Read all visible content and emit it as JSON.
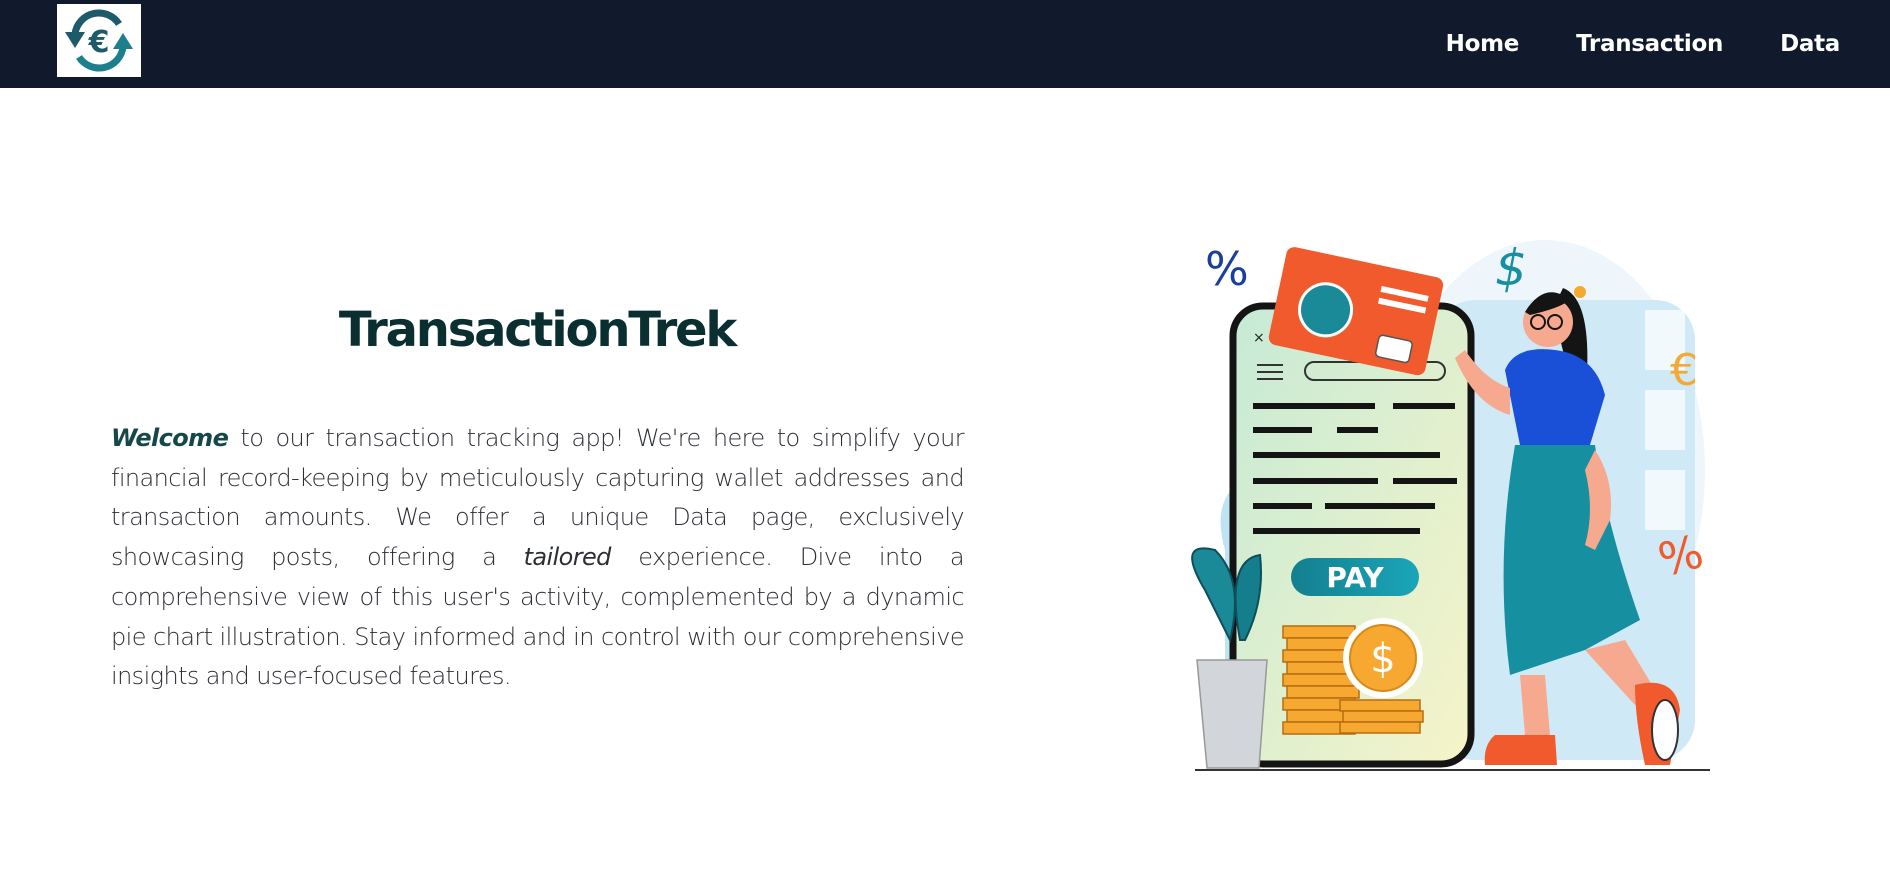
{
  "navbar": {
    "logo_icon": "euro-exchange-icon",
    "links": [
      {
        "label": "Home"
      },
      {
        "label": "Transaction"
      },
      {
        "label": "Data"
      }
    ]
  },
  "hero": {
    "title": "TransactionTrek",
    "welcome": "Welcome",
    "text_part1": " to our transaction tracking app! We're here to simplify your financial record-keeping by meticulously capturing wallet addresses and transaction amounts. We offer a unique Data page, exclusively showcasing posts, offering a ",
    "tailored": "tailored",
    "text_part2": " experience. Dive into a comprehensive view of this user's activity, complemented by a dynamic pie chart illustration. Stay informed and in control with our comprehensive insights and user-focused features."
  },
  "illustration": {
    "pay_label": "PAY",
    "percent_glyph": "%",
    "dollar_glyph": "$",
    "euro_glyph": "€"
  },
  "colors": {
    "navbar_bg": "#111a2c",
    "title": "#0b2e30",
    "accent_teal": "#1690a0",
    "accent_orange": "#f05a2c"
  }
}
